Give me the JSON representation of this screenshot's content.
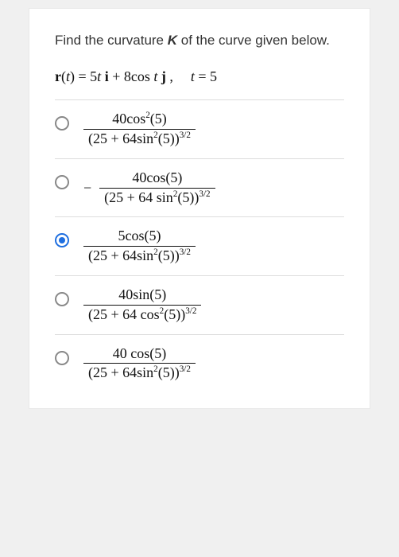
{
  "prompt": {
    "text_before_k": "Find the curvature ",
    "k_symbol": "K",
    "text_after_k": " of the curve given below."
  },
  "equation": {
    "lhs": "r",
    "var": "t",
    "rhs_a": " = 5",
    "unit_i": "i",
    "rhs_b": " + 8cos",
    "unit_j": "j",
    "comma": ",",
    "cond_var": "t",
    "cond_eq": " = 5"
  },
  "choices": [
    {
      "id": "a",
      "selected": false,
      "neg": "",
      "num_a": "40cos",
      "num_exp": "2",
      "num_b": "(5)",
      "den_a": "(25 + 64sin",
      "den_exp": "2",
      "den_b": "(5))",
      "den_outer_exp": "3/2"
    },
    {
      "id": "b",
      "selected": false,
      "neg": "−",
      "num_a": "40cos",
      "num_exp": "",
      "num_b": "(5)",
      "den_a": "(25 + 64 sin",
      "den_exp": "2",
      "den_b": "(5))",
      "den_outer_exp": "3/2"
    },
    {
      "id": "c",
      "selected": true,
      "neg": "",
      "num_a": "5cos",
      "num_exp": "",
      "num_b": "(5)",
      "den_a": "(25 + 64sin",
      "den_exp": "2",
      "den_b": "(5))",
      "den_outer_exp": "3/2"
    },
    {
      "id": "d",
      "selected": false,
      "neg": "",
      "num_a": "40sin",
      "num_exp": "",
      "num_b": "(5)",
      "den_a": "(25 + 64 cos",
      "den_exp": "2",
      "den_b": "(5))",
      "den_outer_exp": "3/2"
    },
    {
      "id": "e",
      "selected": false,
      "neg": "",
      "num_a": "40 cos",
      "num_exp": "",
      "num_b": "(5)",
      "den_a": "(25 + 64sin",
      "den_exp": "2",
      "den_b": "(5))",
      "den_outer_exp": "3/2"
    }
  ]
}
